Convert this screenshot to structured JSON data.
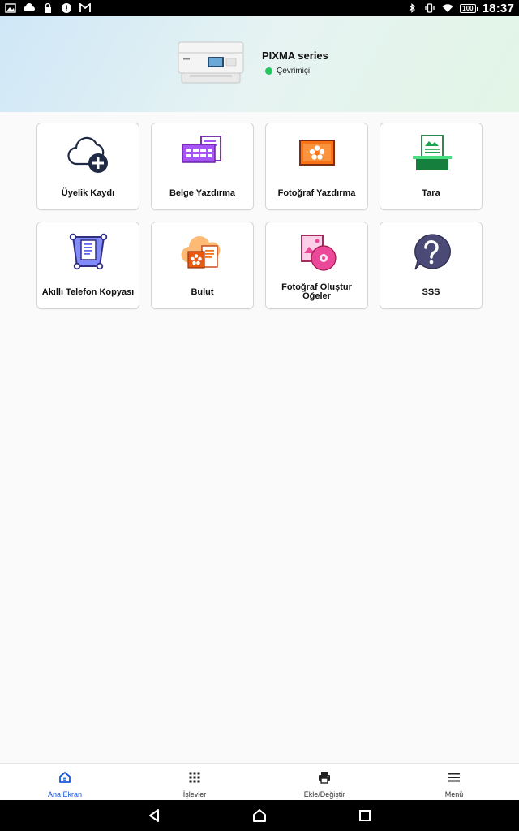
{
  "status_bar": {
    "time": "18:37",
    "battery": "100",
    "left_icons": [
      "image-icon",
      "cloud-icon",
      "lock-icon",
      "alert-icon",
      "gmail-icon"
    ],
    "right_icons": [
      "bluetooth-icon",
      "vibrate-icon",
      "wifi-icon",
      "battery-icon"
    ]
  },
  "header": {
    "printer_name": "PIXMA series",
    "status_text": "Çevrimiçi",
    "status_color": "#22c55e"
  },
  "tiles": [
    {
      "label": "Üyelik Kaydı",
      "icon": "cloud-plus-icon"
    },
    {
      "label": "Belge Yazdırma",
      "icon": "document-print-icon"
    },
    {
      "label": "Fotoğraf Yazdırma",
      "icon": "photo-print-icon"
    },
    {
      "label": "Tara",
      "icon": "scan-icon"
    },
    {
      "label": "Akıllı Telefon Kopyası",
      "icon": "smartphone-copy-icon"
    },
    {
      "label": "Bulut",
      "icon": "cloud-icon"
    },
    {
      "label": "Fotoğraf Oluştur Öğeler",
      "icon": "photo-disc-icon"
    },
    {
      "label": "SSS",
      "icon": "faq-icon"
    }
  ],
  "bottom_nav": {
    "items": [
      {
        "label": "Ana Ekran",
        "icon": "home-icon",
        "active": true
      },
      {
        "label": "İşlevler",
        "icon": "grid-dots-icon",
        "active": false
      },
      {
        "label": "Ekle/Değiştir",
        "icon": "printer-icon",
        "active": false
      },
      {
        "label": "Menü",
        "icon": "hamburger-icon",
        "active": false
      }
    ],
    "active_color": "#1a56db"
  },
  "system_nav": [
    "back-icon",
    "home-circle-icon",
    "recents-icon"
  ]
}
